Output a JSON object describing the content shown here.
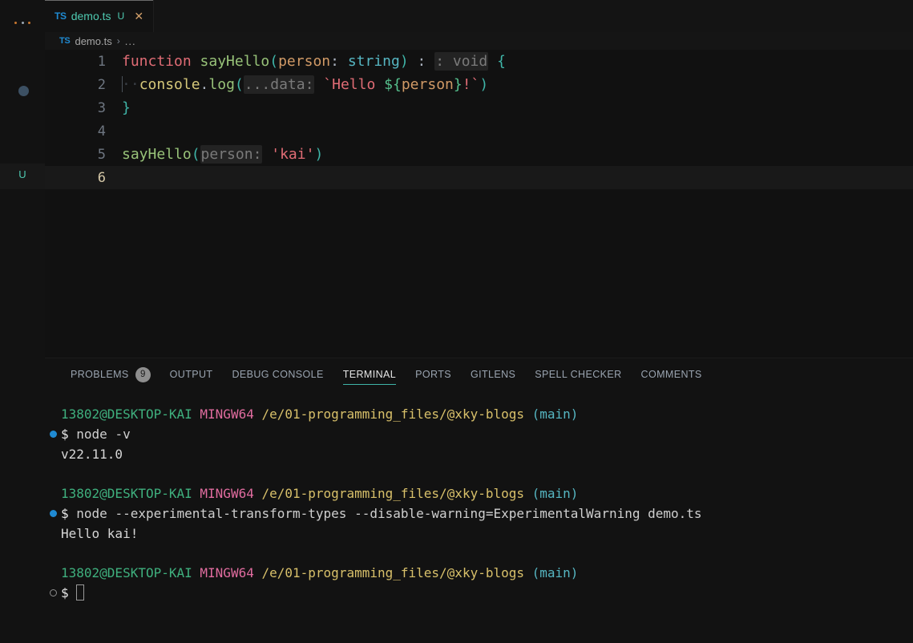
{
  "activity_bar": {
    "more_actions_icon": "ellipsis-icon",
    "breakpoint_icon": "breakpoint-dot-icon",
    "git_status_badge": "U"
  },
  "tabs": [
    {
      "file_type_badge": "TS",
      "label": "demo.ts",
      "modifier": "U",
      "close_icon": "close-icon",
      "active": true
    }
  ],
  "breadcrumb": {
    "file_type_badge": "TS",
    "file": "demo.ts",
    "separator": "›",
    "overflow": "..."
  },
  "editor": {
    "lines": [
      {
        "number": "1",
        "tokens": [
          {
            "text": "function ",
            "kind": "keyword"
          },
          {
            "text": "sayHello",
            "kind": "function"
          },
          {
            "text": "(",
            "kind": "punctuation"
          },
          {
            "text": "person",
            "kind": "parameter"
          },
          {
            "text": ": ",
            "kind": "plain-punc"
          },
          {
            "text": "string",
            "kind": "type"
          },
          {
            "text": ")",
            "kind": "punctuation"
          },
          {
            "text": " : ",
            "kind": "inlay-lead"
          },
          {
            "text": ": void",
            "kind": "inlay"
          },
          {
            "text": " {",
            "kind": "brace"
          }
        ]
      },
      {
        "number": "2",
        "tokens": [
          {
            "text": "console",
            "kind": "object"
          },
          {
            "text": ".",
            "kind": "plain-punc"
          },
          {
            "text": "log",
            "kind": "method"
          },
          {
            "text": "(",
            "kind": "punctuation"
          },
          {
            "text": "...data:",
            "kind": "inlay"
          },
          {
            "text": " `Hello ",
            "kind": "template"
          },
          {
            "text": "${",
            "kind": "interpolation"
          },
          {
            "text": "person",
            "kind": "parameter"
          },
          {
            "text": "}",
            "kind": "interpolation"
          },
          {
            "text": "!`",
            "kind": "template"
          },
          {
            "text": ")",
            "kind": "punctuation"
          }
        ]
      },
      {
        "number": "3",
        "tokens": [
          {
            "text": "}",
            "kind": "brace"
          }
        ]
      },
      {
        "number": "4",
        "tokens": []
      },
      {
        "number": "5",
        "tokens": [
          {
            "text": "sayHello",
            "kind": "function"
          },
          {
            "text": "(",
            "kind": "punctuation"
          },
          {
            "text": "person:",
            "kind": "inlay"
          },
          {
            "text": " ",
            "kind": "plain-punc"
          },
          {
            "text": "'kai'",
            "kind": "string"
          },
          {
            "text": ")",
            "kind": "punctuation"
          }
        ]
      },
      {
        "number": "6",
        "tokens": [],
        "current": true
      }
    ]
  },
  "panel": {
    "tabs": [
      {
        "label": "PROBLEMS",
        "count": "9",
        "active": false
      },
      {
        "label": "OUTPUT",
        "active": false
      },
      {
        "label": "DEBUG CONSOLE",
        "active": false
      },
      {
        "label": "TERMINAL",
        "active": true
      },
      {
        "label": "PORTS",
        "active": false
      },
      {
        "label": "GITLENS",
        "active": false
      },
      {
        "label": "SPELL CHECKER",
        "active": false
      },
      {
        "label": "COMMENTS",
        "active": false
      }
    ]
  },
  "terminal": {
    "prompt": {
      "user_host": "13802@DESKTOP-KAI",
      "shell": "MINGW64",
      "path": "/e/01-programming_files/@xky-blogs",
      "git_branch": "(main)",
      "symbol": "$"
    },
    "blocks": [
      {
        "decoration": "success",
        "command": "node -v",
        "output": [
          "v22.11.0"
        ]
      },
      {
        "decoration": "success",
        "command": "node --experimental-transform-types --disable-warning=ExperimentalWarning demo.ts",
        "output": [
          "Hello kai!"
        ]
      },
      {
        "decoration": "pending",
        "command": "",
        "output": []
      }
    ]
  },
  "colors": {
    "background": "#111111",
    "panel_background": "#121212",
    "accent": "#3fb5a8",
    "tab_active_text": "#4ec9b0",
    "terminal_user": "#3fb07e",
    "terminal_host": "#e06c9f",
    "terminal_path": "#d8c06a",
    "terminal_git": "#56b6c2",
    "decoration_success": "#1f8ad2"
  }
}
